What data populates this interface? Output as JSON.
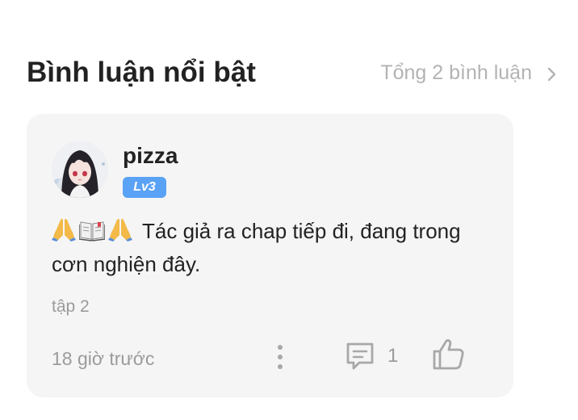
{
  "section": {
    "title": "Bình luận nổi bật",
    "total_label": "Tổng 2 bình luận"
  },
  "comment": {
    "username": "pizza",
    "level": "Lv3",
    "emojis": [
      "pray-emoji",
      "open-book-emoji",
      "pray-emoji"
    ],
    "text": "Tác giả ra chap tiếp đi, đang trong cơn nghiện đây.",
    "episode": "tập 2",
    "time": "18 giờ trước",
    "reply_count": "1"
  },
  "colors": {
    "card_background": "#f5f5f5",
    "level_badge": "#5aa2f5",
    "muted_text": "#9b9b9b",
    "title_text": "#222222"
  },
  "icons": {
    "header_link": "chevron-right-icon",
    "more": "more-vertical-icon",
    "reply": "comment-icon",
    "like": "thumbs-up-icon"
  }
}
